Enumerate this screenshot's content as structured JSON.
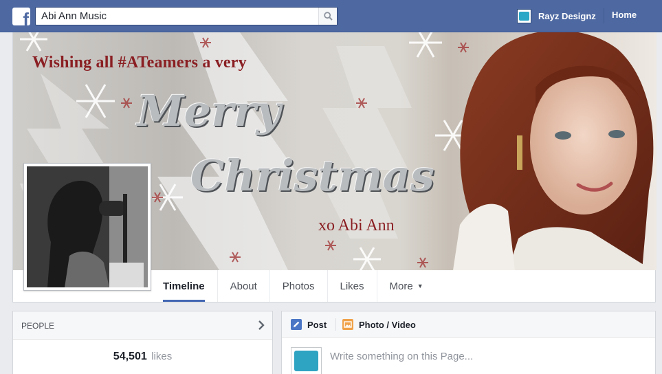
{
  "topbar": {
    "search_value": "Abi Ann Music",
    "user_name": "Rayz Designz",
    "home_label": "Home"
  },
  "cover": {
    "wish_text": "Wishing all #ATeamers a very",
    "merry_text": "Merry",
    "christmas_text": "Christmas",
    "signature": "xo Abi Ann"
  },
  "tabs": [
    {
      "label": "Timeline"
    },
    {
      "label": "About"
    },
    {
      "label": "Photos"
    },
    {
      "label": "Likes"
    },
    {
      "label": "More"
    }
  ],
  "people": {
    "title": "PEOPLE",
    "likes_count": "54,501",
    "likes_label": "likes"
  },
  "composer": {
    "post_label": "Post",
    "photo_label": "Photo / Video",
    "placeholder": "Write something on this Page..."
  },
  "colors": {
    "topbar": "#4e69a2",
    "accent": "#4267b2",
    "cover_text": "#8a1f23"
  },
  "icons": {
    "logo": "facebook-logo-icon",
    "search": "search-icon",
    "chevron": "chevron-right-icon",
    "post": "pencil-icon",
    "photo": "photo-icon"
  }
}
